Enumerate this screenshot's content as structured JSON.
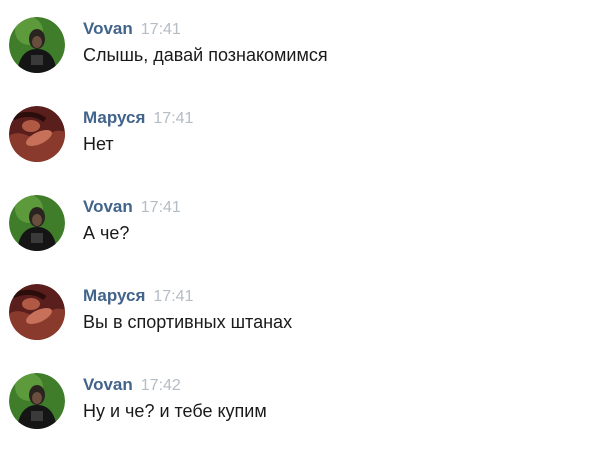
{
  "colors": {
    "author": "#42648b",
    "time": "#b4bcc4",
    "text": "#1a1a1a"
  },
  "messages": [
    {
      "author": "Vovan",
      "time": "17:41",
      "text": "Слышь, давай познакомимся",
      "avatar": "vovan-avatar"
    },
    {
      "author": "Маруся",
      "time": "17:41",
      "text": "Нет",
      "avatar": "marusya-avatar"
    },
    {
      "author": "Vovan",
      "time": "17:41",
      "text": "А че?",
      "avatar": "vovan-avatar"
    },
    {
      "author": "Маруся",
      "time": "17:41",
      "text": "Вы в спортивных штанах",
      "avatar": "marusya-avatar"
    },
    {
      "author": "Vovan",
      "time": "17:42",
      "text": "Ну и че? и тебе купим",
      "avatar": "vovan-avatar"
    }
  ]
}
